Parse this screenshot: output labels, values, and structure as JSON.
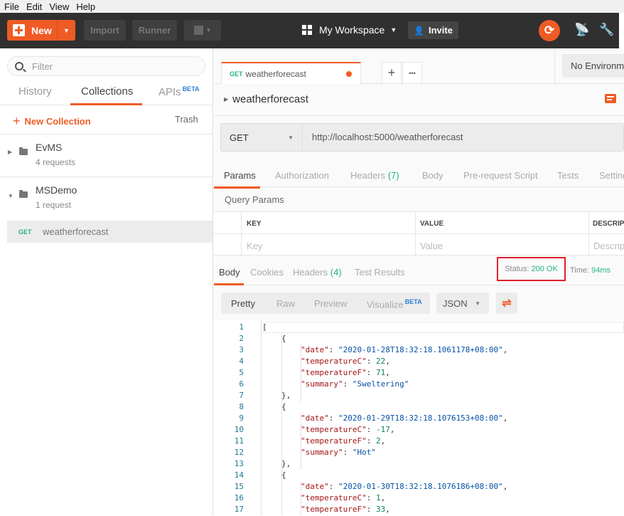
{
  "menu": [
    "File",
    "Edit",
    "View",
    "Help"
  ],
  "toolbar": {
    "new_label": "New",
    "import_label": "Import",
    "runner_label": "Runner",
    "workspace_label": "My Workspace",
    "invite_label": "Invite",
    "icons": [
      "plus-icon",
      "caret-down-icon",
      "new-window-icon",
      "grid-icon",
      "add-user-icon",
      "sync-icon",
      "satellite-icon",
      "wrench-icon"
    ],
    "accent_color": "#ef5b25"
  },
  "sidebar": {
    "filter_placeholder": "Filter",
    "tabs": [
      {
        "label": "History"
      },
      {
        "label": "Collections",
        "active": true
      },
      {
        "label": "APIs",
        "badge": "BETA"
      }
    ],
    "new_collection_label": "New Collection",
    "trash_label": "Trash",
    "collections": [
      {
        "name": "EvMS",
        "count": "4 requests",
        "expanded": false
      },
      {
        "name": "MSDemo",
        "count": "1 request",
        "expanded": true,
        "requests": [
          {
            "method": "GET",
            "name": "weatherforecast"
          }
        ]
      }
    ]
  },
  "request_tab": {
    "method": "GET",
    "name": "weatherforecast",
    "unsaved": true
  },
  "tab_actions": {
    "add": "+",
    "more": "•••"
  },
  "environment": "No Environment",
  "request": {
    "name": "weatherforecast",
    "method": "GET",
    "url": "http://localhost:5000/weatherforecast"
  },
  "param_tabs": [
    {
      "label": "Params",
      "active": true
    },
    {
      "label": "Authorization"
    },
    {
      "label": "Headers",
      "count": "(7)"
    },
    {
      "label": "Body"
    },
    {
      "label": "Pre-request Script"
    },
    {
      "label": "Tests"
    },
    {
      "label": "Settings"
    }
  ],
  "query_params": {
    "title": "Query Params",
    "headers": [
      "KEY",
      "VALUE",
      "DESCRIPTION"
    ],
    "placeholders": [
      "Key",
      "Value",
      "Description"
    ]
  },
  "response_tabs": [
    {
      "label": "Body",
      "active": true
    },
    {
      "label": "Cookies"
    },
    {
      "label": "Headers",
      "count": "(4)"
    },
    {
      "label": "Test Results"
    }
  ],
  "response_meta": {
    "status_label": "Status:",
    "status_value": "200 OK",
    "time_label": "Time:",
    "time_value": "94ms"
  },
  "view_modes": [
    {
      "label": "Pretty",
      "active": true
    },
    {
      "label": "Raw"
    },
    {
      "label": "Preview"
    },
    {
      "label": "Visualize",
      "badge": "BETA"
    }
  ],
  "format": "JSON",
  "response_body": [
    {
      "n": 1,
      "indent": 0,
      "parts": [
        [
          "p",
          "["
        ]
      ]
    },
    {
      "n": 2,
      "indent": 1,
      "parts": [
        [
          "p",
          "{"
        ]
      ]
    },
    {
      "n": 3,
      "indent": 2,
      "parts": [
        [
          "k",
          "\"date\""
        ],
        [
          "p",
          ": "
        ],
        [
          "s",
          "\"2020-01-28T18:32:18.1061178+08:00\""
        ],
        [
          "p",
          ","
        ]
      ]
    },
    {
      "n": 4,
      "indent": 2,
      "parts": [
        [
          "k",
          "\"temperatureC\""
        ],
        [
          "p",
          ": "
        ],
        [
          "n",
          "22"
        ],
        [
          "p",
          ","
        ]
      ]
    },
    {
      "n": 5,
      "indent": 2,
      "parts": [
        [
          "k",
          "\"temperatureF\""
        ],
        [
          "p",
          ": "
        ],
        [
          "n",
          "71"
        ],
        [
          "p",
          ","
        ]
      ]
    },
    {
      "n": 6,
      "indent": 2,
      "parts": [
        [
          "k",
          "\"summary\""
        ],
        [
          "p",
          ": "
        ],
        [
          "s",
          "\"Sweltering\""
        ]
      ]
    },
    {
      "n": 7,
      "indent": 1,
      "parts": [
        [
          "p",
          "},"
        ]
      ]
    },
    {
      "n": 8,
      "indent": 1,
      "parts": [
        [
          "p",
          "{"
        ]
      ]
    },
    {
      "n": 9,
      "indent": 2,
      "parts": [
        [
          "k",
          "\"date\""
        ],
        [
          "p",
          ": "
        ],
        [
          "s",
          "\"2020-01-29T18:32:18.1076153+08:00\""
        ],
        [
          "p",
          ","
        ]
      ]
    },
    {
      "n": 10,
      "indent": 2,
      "parts": [
        [
          "k",
          "\"temperatureC\""
        ],
        [
          "p",
          ": "
        ],
        [
          "n",
          "-17"
        ],
        [
          "p",
          ","
        ]
      ]
    },
    {
      "n": 11,
      "indent": 2,
      "parts": [
        [
          "k",
          "\"temperatureF\""
        ],
        [
          "p",
          ": "
        ],
        [
          "n",
          "2"
        ],
        [
          "p",
          ","
        ]
      ]
    },
    {
      "n": 12,
      "indent": 2,
      "parts": [
        [
          "k",
          "\"summary\""
        ],
        [
          "p",
          ": "
        ],
        [
          "s",
          "\"Hot\""
        ]
      ]
    },
    {
      "n": 13,
      "indent": 1,
      "parts": [
        [
          "p",
          "},"
        ]
      ]
    },
    {
      "n": 14,
      "indent": 1,
      "parts": [
        [
          "p",
          "{"
        ]
      ]
    },
    {
      "n": 15,
      "indent": 2,
      "parts": [
        [
          "k",
          "\"date\""
        ],
        [
          "p",
          ": "
        ],
        [
          "s",
          "\"2020-01-30T18:32:18.1076186+08:00\""
        ],
        [
          "p",
          ","
        ]
      ]
    },
    {
      "n": 16,
      "indent": 2,
      "parts": [
        [
          "k",
          "\"temperatureC\""
        ],
        [
          "p",
          ": "
        ],
        [
          "n",
          "1"
        ],
        [
          "p",
          ","
        ]
      ]
    },
    {
      "n": 17,
      "indent": 2,
      "parts": [
        [
          "k",
          "\"temperatureF\""
        ],
        [
          "p",
          ": "
        ],
        [
          "n",
          "33"
        ],
        [
          "p",
          ","
        ]
      ]
    }
  ]
}
